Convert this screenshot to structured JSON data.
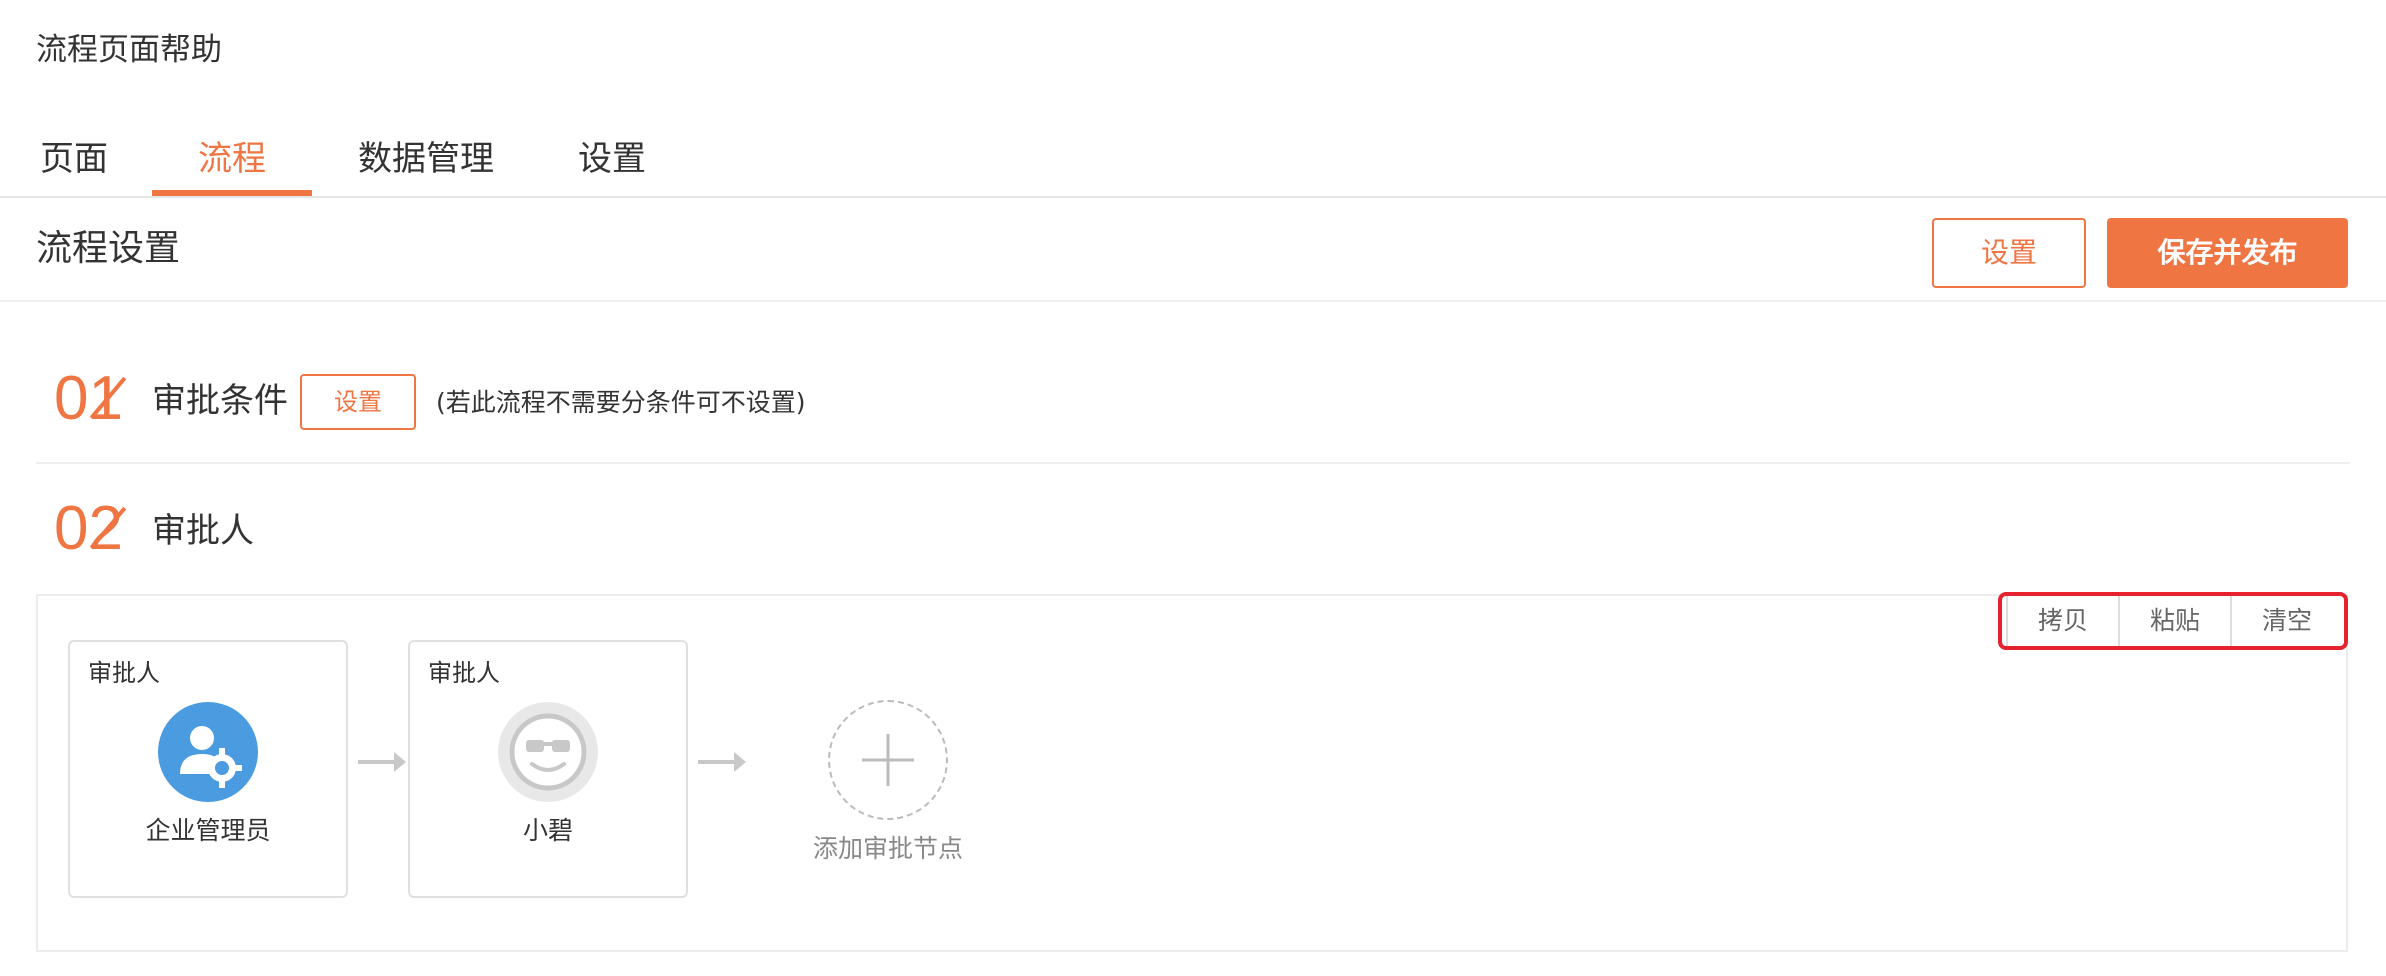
{
  "page": {
    "title": "流程页面帮助"
  },
  "tabs": [
    {
      "label": "页面"
    },
    {
      "label": "流程"
    },
    {
      "label": "数据管理"
    },
    {
      "label": "设置"
    }
  ],
  "header": {
    "title": "流程设置",
    "settings_label": "设置",
    "publish_label": "保存并发布"
  },
  "step1": {
    "number": "01",
    "title": "审批条件",
    "button_label": "设置",
    "hint": "(若此流程不需要分条件可不设置)"
  },
  "step2": {
    "number": "02",
    "title": "审批人"
  },
  "toolbar": {
    "copy": "拷贝",
    "paste": "粘贴",
    "clear": "清空"
  },
  "nodes": [
    {
      "label": "审批人",
      "name": "企业管理员",
      "avatar": "admin-gear-icon",
      "color": "#4a9be0"
    },
    {
      "label": "审批人",
      "name": "小碧",
      "avatar": "cool-face-icon",
      "color": "#e8e8e8"
    }
  ],
  "add_node": {
    "label": "添加审批节点"
  },
  "colors": {
    "accent": "#ef7543",
    "highlight": "#e4232f"
  }
}
